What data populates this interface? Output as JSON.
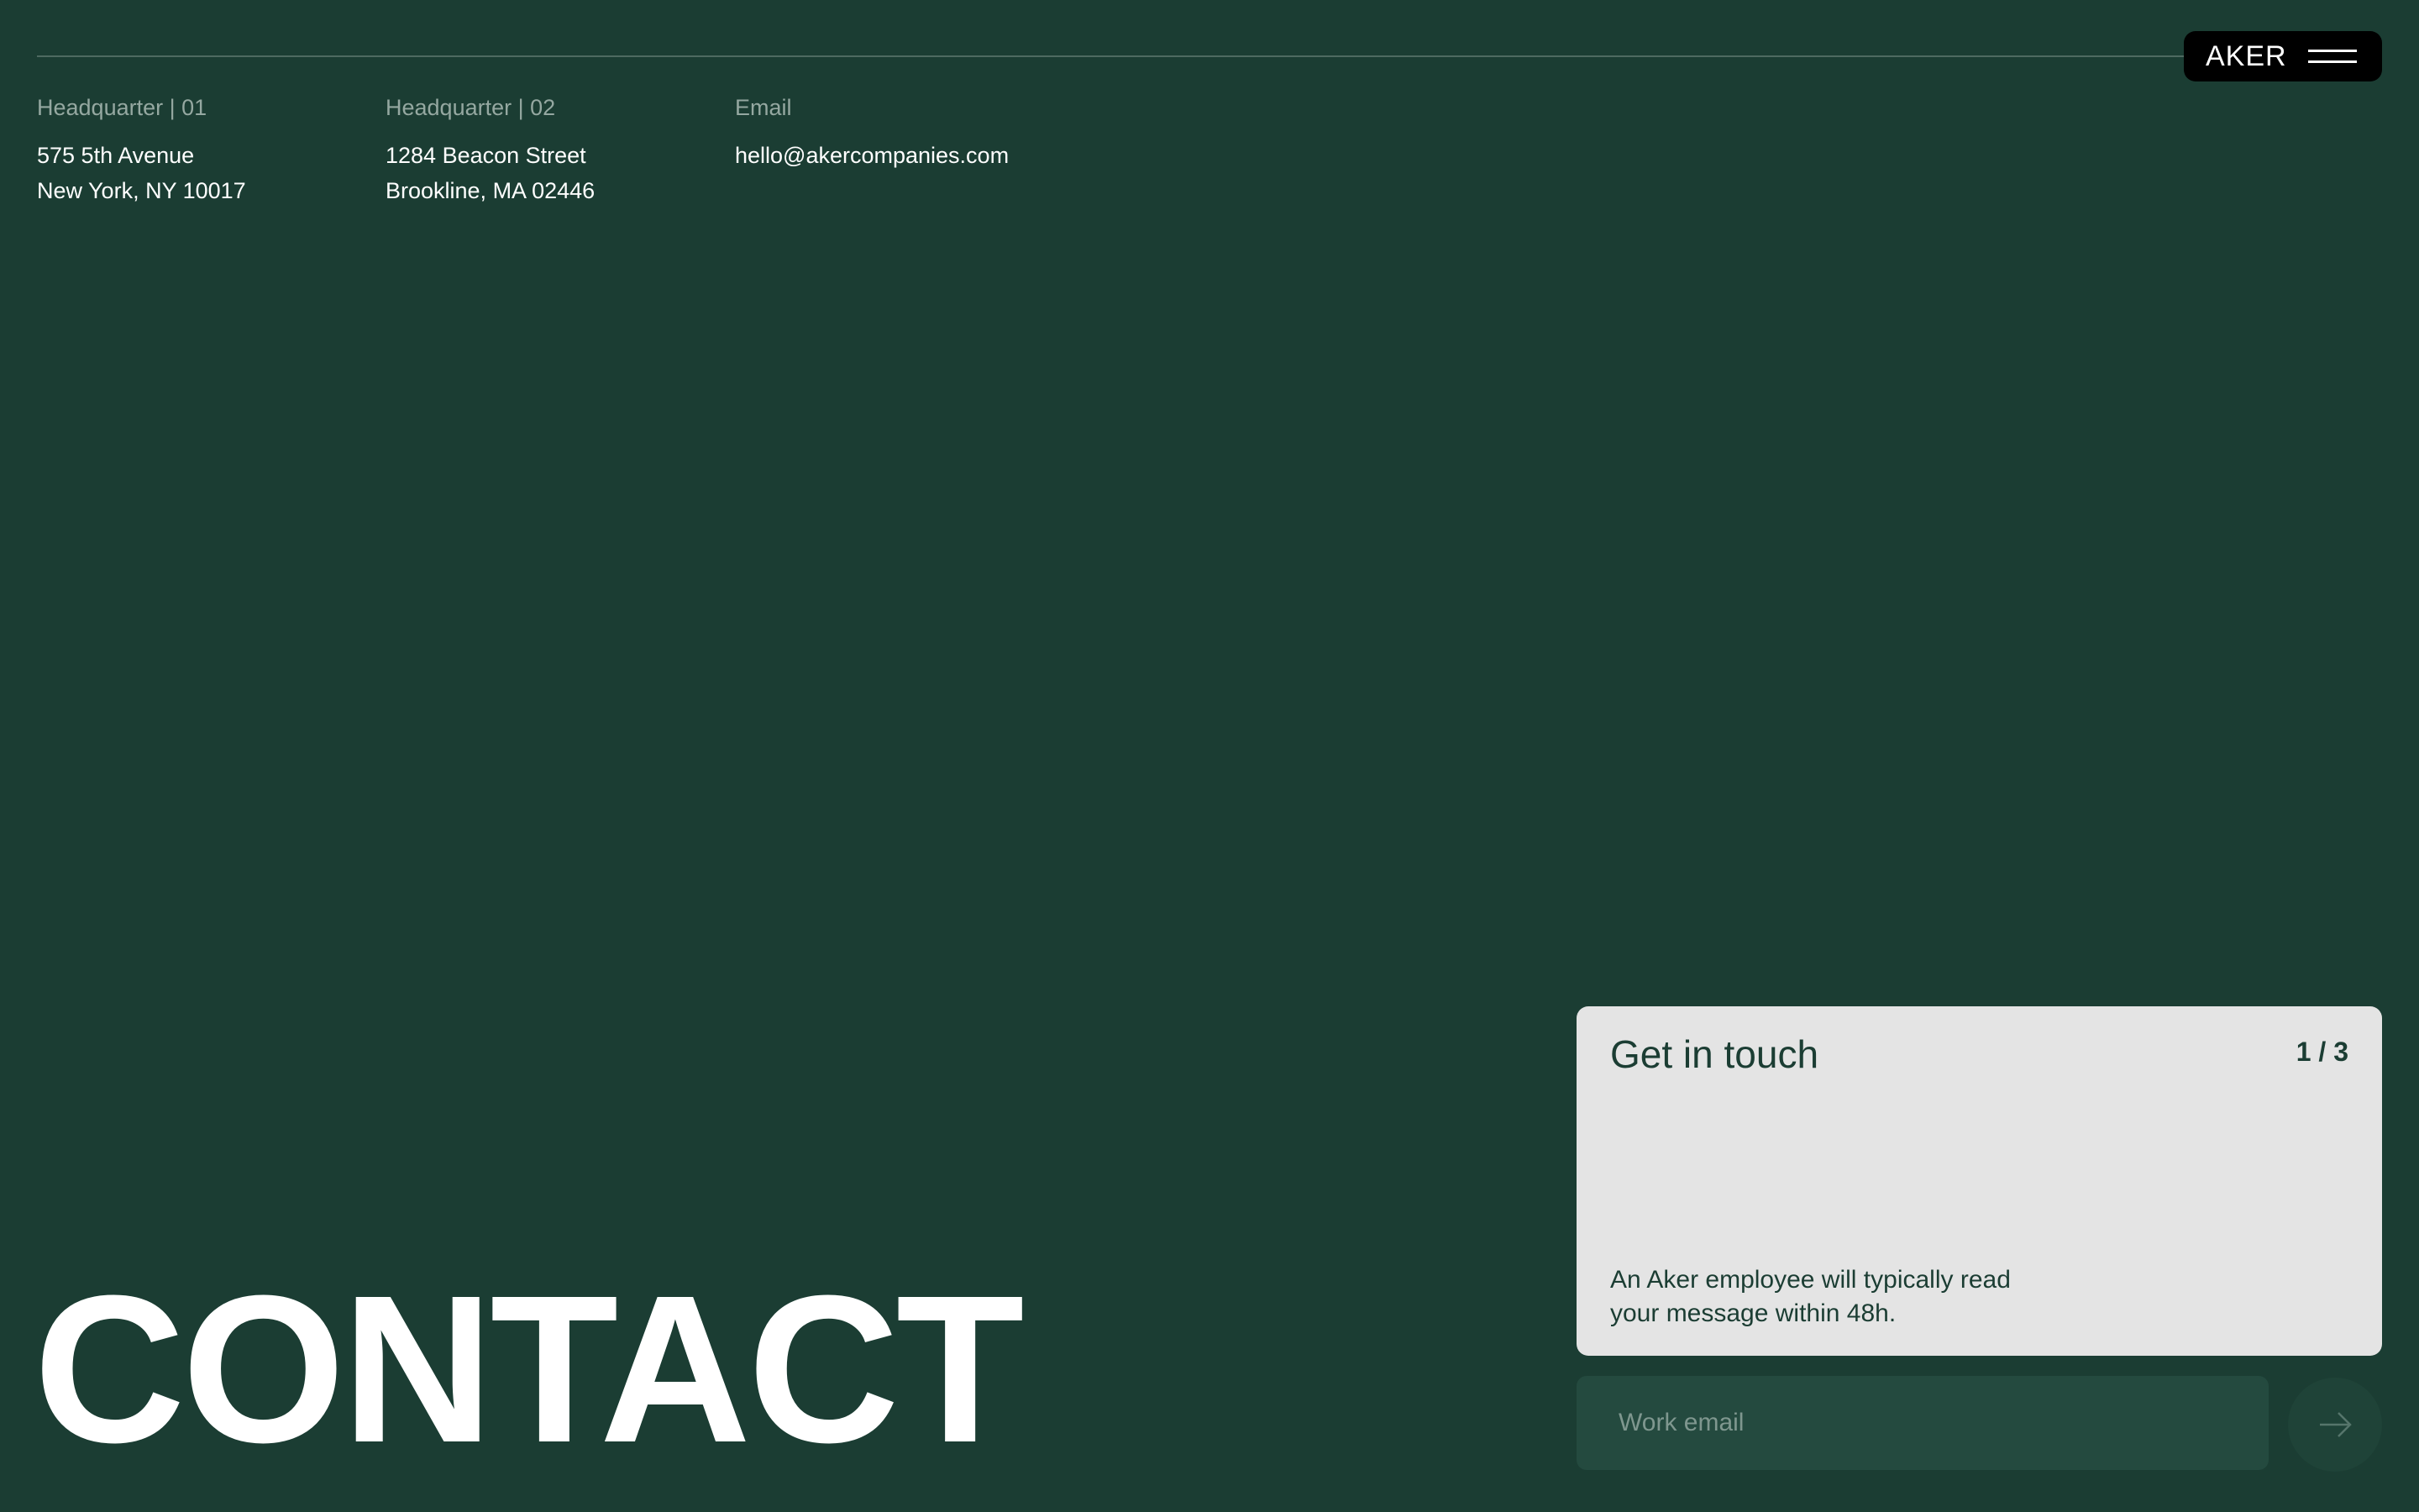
{
  "header": {
    "brand": "AKER",
    "menu_icon": "hamburger-menu-icon"
  },
  "contact_info": [
    {
      "label": "Headquarter | 01",
      "lines": [
        "575 5th Avenue",
        "New York, NY 10017"
      ]
    },
    {
      "label": "Headquarter | 02",
      "lines": [
        "1284 Beacon Street",
        "Brookline, MA 02446"
      ]
    },
    {
      "label": "Email",
      "lines": [
        "hello@akercompanies.com"
      ]
    }
  ],
  "hero": {
    "title": "CONTACT"
  },
  "form_card": {
    "title": "Get in touch",
    "step": "1 / 3",
    "note": "An Aker employee will typically read your message within 48h."
  },
  "email_input": {
    "placeholder": "Work email",
    "value": ""
  },
  "submit": {
    "icon": "arrow-right-icon"
  },
  "colors": {
    "background": "#1b3d33",
    "card": "#e4e4e4",
    "text_dark": "#1b3d33",
    "label_muted": "#95a8a1",
    "input_bg": "#244a3f"
  }
}
